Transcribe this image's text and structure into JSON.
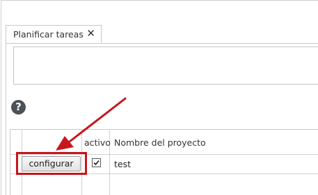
{
  "tab": {
    "title": "Planificar tareas",
    "close_symbol": "✕"
  },
  "help": {
    "symbol": "?"
  },
  "table": {
    "headers": {
      "active": "activo",
      "project_name": "Nombre del proyecto"
    },
    "rows": [
      {
        "action_label": "configurar",
        "active": true,
        "project_name": "test"
      }
    ]
  },
  "colors": {
    "highlight": "#c8161b",
    "help_icon_bg": "#4b5257"
  }
}
